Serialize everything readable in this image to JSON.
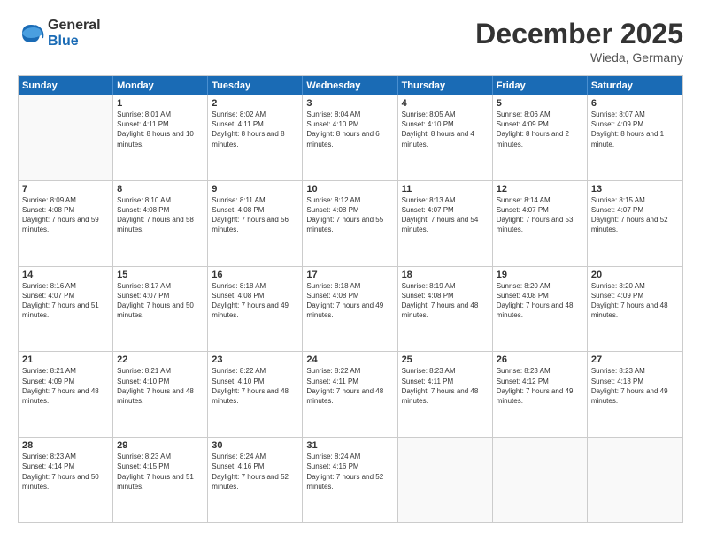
{
  "logo": {
    "general": "General",
    "blue": "Blue"
  },
  "title": "December 2025",
  "location": "Wieda, Germany",
  "weekdays": [
    "Sunday",
    "Monday",
    "Tuesday",
    "Wednesday",
    "Thursday",
    "Friday",
    "Saturday"
  ],
  "rows": [
    [
      {
        "day": "",
        "empty": true
      },
      {
        "day": "1",
        "sunrise": "Sunrise: 8:01 AM",
        "sunset": "Sunset: 4:11 PM",
        "daylight": "Daylight: 8 hours and 10 minutes."
      },
      {
        "day": "2",
        "sunrise": "Sunrise: 8:02 AM",
        "sunset": "Sunset: 4:11 PM",
        "daylight": "Daylight: 8 hours and 8 minutes."
      },
      {
        "day": "3",
        "sunrise": "Sunrise: 8:04 AM",
        "sunset": "Sunset: 4:10 PM",
        "daylight": "Daylight: 8 hours and 6 minutes."
      },
      {
        "day": "4",
        "sunrise": "Sunrise: 8:05 AM",
        "sunset": "Sunset: 4:10 PM",
        "daylight": "Daylight: 8 hours and 4 minutes."
      },
      {
        "day": "5",
        "sunrise": "Sunrise: 8:06 AM",
        "sunset": "Sunset: 4:09 PM",
        "daylight": "Daylight: 8 hours and 2 minutes."
      },
      {
        "day": "6",
        "sunrise": "Sunrise: 8:07 AM",
        "sunset": "Sunset: 4:09 PM",
        "daylight": "Daylight: 8 hours and 1 minute."
      }
    ],
    [
      {
        "day": "7",
        "sunrise": "Sunrise: 8:09 AM",
        "sunset": "Sunset: 4:08 PM",
        "daylight": "Daylight: 7 hours and 59 minutes."
      },
      {
        "day": "8",
        "sunrise": "Sunrise: 8:10 AM",
        "sunset": "Sunset: 4:08 PM",
        "daylight": "Daylight: 7 hours and 58 minutes."
      },
      {
        "day": "9",
        "sunrise": "Sunrise: 8:11 AM",
        "sunset": "Sunset: 4:08 PM",
        "daylight": "Daylight: 7 hours and 56 minutes."
      },
      {
        "day": "10",
        "sunrise": "Sunrise: 8:12 AM",
        "sunset": "Sunset: 4:08 PM",
        "daylight": "Daylight: 7 hours and 55 minutes."
      },
      {
        "day": "11",
        "sunrise": "Sunrise: 8:13 AM",
        "sunset": "Sunset: 4:07 PM",
        "daylight": "Daylight: 7 hours and 54 minutes."
      },
      {
        "day": "12",
        "sunrise": "Sunrise: 8:14 AM",
        "sunset": "Sunset: 4:07 PM",
        "daylight": "Daylight: 7 hours and 53 minutes."
      },
      {
        "day": "13",
        "sunrise": "Sunrise: 8:15 AM",
        "sunset": "Sunset: 4:07 PM",
        "daylight": "Daylight: 7 hours and 52 minutes."
      }
    ],
    [
      {
        "day": "14",
        "sunrise": "Sunrise: 8:16 AM",
        "sunset": "Sunset: 4:07 PM",
        "daylight": "Daylight: 7 hours and 51 minutes."
      },
      {
        "day": "15",
        "sunrise": "Sunrise: 8:17 AM",
        "sunset": "Sunset: 4:07 PM",
        "daylight": "Daylight: 7 hours and 50 minutes."
      },
      {
        "day": "16",
        "sunrise": "Sunrise: 8:18 AM",
        "sunset": "Sunset: 4:08 PM",
        "daylight": "Daylight: 7 hours and 49 minutes."
      },
      {
        "day": "17",
        "sunrise": "Sunrise: 8:18 AM",
        "sunset": "Sunset: 4:08 PM",
        "daylight": "Daylight: 7 hours and 49 minutes."
      },
      {
        "day": "18",
        "sunrise": "Sunrise: 8:19 AM",
        "sunset": "Sunset: 4:08 PM",
        "daylight": "Daylight: 7 hours and 48 minutes."
      },
      {
        "day": "19",
        "sunrise": "Sunrise: 8:20 AM",
        "sunset": "Sunset: 4:08 PM",
        "daylight": "Daylight: 7 hours and 48 minutes."
      },
      {
        "day": "20",
        "sunrise": "Sunrise: 8:20 AM",
        "sunset": "Sunset: 4:09 PM",
        "daylight": "Daylight: 7 hours and 48 minutes."
      }
    ],
    [
      {
        "day": "21",
        "sunrise": "Sunrise: 8:21 AM",
        "sunset": "Sunset: 4:09 PM",
        "daylight": "Daylight: 7 hours and 48 minutes."
      },
      {
        "day": "22",
        "sunrise": "Sunrise: 8:21 AM",
        "sunset": "Sunset: 4:10 PM",
        "daylight": "Daylight: 7 hours and 48 minutes."
      },
      {
        "day": "23",
        "sunrise": "Sunrise: 8:22 AM",
        "sunset": "Sunset: 4:10 PM",
        "daylight": "Daylight: 7 hours and 48 minutes."
      },
      {
        "day": "24",
        "sunrise": "Sunrise: 8:22 AM",
        "sunset": "Sunset: 4:11 PM",
        "daylight": "Daylight: 7 hours and 48 minutes."
      },
      {
        "day": "25",
        "sunrise": "Sunrise: 8:23 AM",
        "sunset": "Sunset: 4:11 PM",
        "daylight": "Daylight: 7 hours and 48 minutes."
      },
      {
        "day": "26",
        "sunrise": "Sunrise: 8:23 AM",
        "sunset": "Sunset: 4:12 PM",
        "daylight": "Daylight: 7 hours and 49 minutes."
      },
      {
        "day": "27",
        "sunrise": "Sunrise: 8:23 AM",
        "sunset": "Sunset: 4:13 PM",
        "daylight": "Daylight: 7 hours and 49 minutes."
      }
    ],
    [
      {
        "day": "28",
        "sunrise": "Sunrise: 8:23 AM",
        "sunset": "Sunset: 4:14 PM",
        "daylight": "Daylight: 7 hours and 50 minutes."
      },
      {
        "day": "29",
        "sunrise": "Sunrise: 8:23 AM",
        "sunset": "Sunset: 4:15 PM",
        "daylight": "Daylight: 7 hours and 51 minutes."
      },
      {
        "day": "30",
        "sunrise": "Sunrise: 8:24 AM",
        "sunset": "Sunset: 4:16 PM",
        "daylight": "Daylight: 7 hours and 52 minutes."
      },
      {
        "day": "31",
        "sunrise": "Sunrise: 8:24 AM",
        "sunset": "Sunset: 4:16 PM",
        "daylight": "Daylight: 7 hours and 52 minutes."
      },
      {
        "day": "",
        "empty": true
      },
      {
        "day": "",
        "empty": true
      },
      {
        "day": "",
        "empty": true
      }
    ]
  ]
}
